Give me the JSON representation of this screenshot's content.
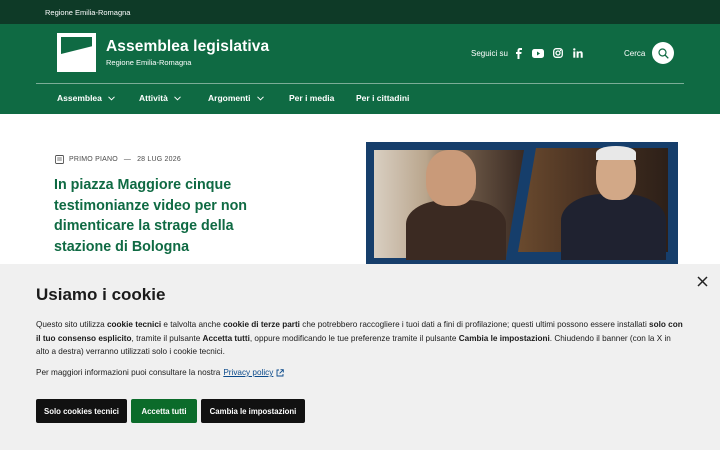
{
  "slim_header": {
    "region_label": "Regione Emilia-Romagna"
  },
  "brand": {
    "title": "Assemblea legislativa",
    "subtitle": "Regione Emilia-Romagna"
  },
  "social": {
    "label": "Seguici su",
    "icons": [
      "facebook-icon",
      "youtube-icon",
      "instagram-icon",
      "linkedin-icon"
    ]
  },
  "search": {
    "label": "Cerca"
  },
  "nav": {
    "items": [
      "Assemblea",
      "Attività",
      "Argomenti",
      "Per i media",
      "Per i cittadini"
    ]
  },
  "article": {
    "kicker": "PRIMO PIANO",
    "date": "28 LUG 2026",
    "title": "In piazza Maggiore cinque testimonianze video per non dimenticare la strage della stazione di Bologna"
  },
  "cookie": {
    "title": "Usiamo i cookie",
    "text_parts": [
      "Questo sito utilizza ",
      "cookie tecnici",
      " e talvolta anche ",
      "cookie di terze parti",
      " che potrebbero raccogliere i tuoi dati a fini di profilazione; questi ultimi possono essere installati ",
      "solo con il tuo consenso esplicito",
      ", tramite il pulsante ",
      "Accetta tutti",
      ", oppure modificando le tue preferenze tramite il pulsante ",
      "Cambia le impostazioni",
      ". Chiudendo il banner (con la X in alto a destra) verranno utilizzati solo i cookie tecnici."
    ],
    "more_prefix": "Per maggiori informazioni puoi consultare la nostra",
    "privacy_link": "Privacy policy",
    "buttons": {
      "technical": "Solo cookies tecnici",
      "accept": "Accetta tutti",
      "settings": "Cambia le impostazioni"
    }
  },
  "colors": {
    "header_green": "#0f6a43",
    "slimbar": "#0e3a27",
    "accept_green": "#0b6b2a",
    "banner_bg": "#f0f0f0"
  }
}
